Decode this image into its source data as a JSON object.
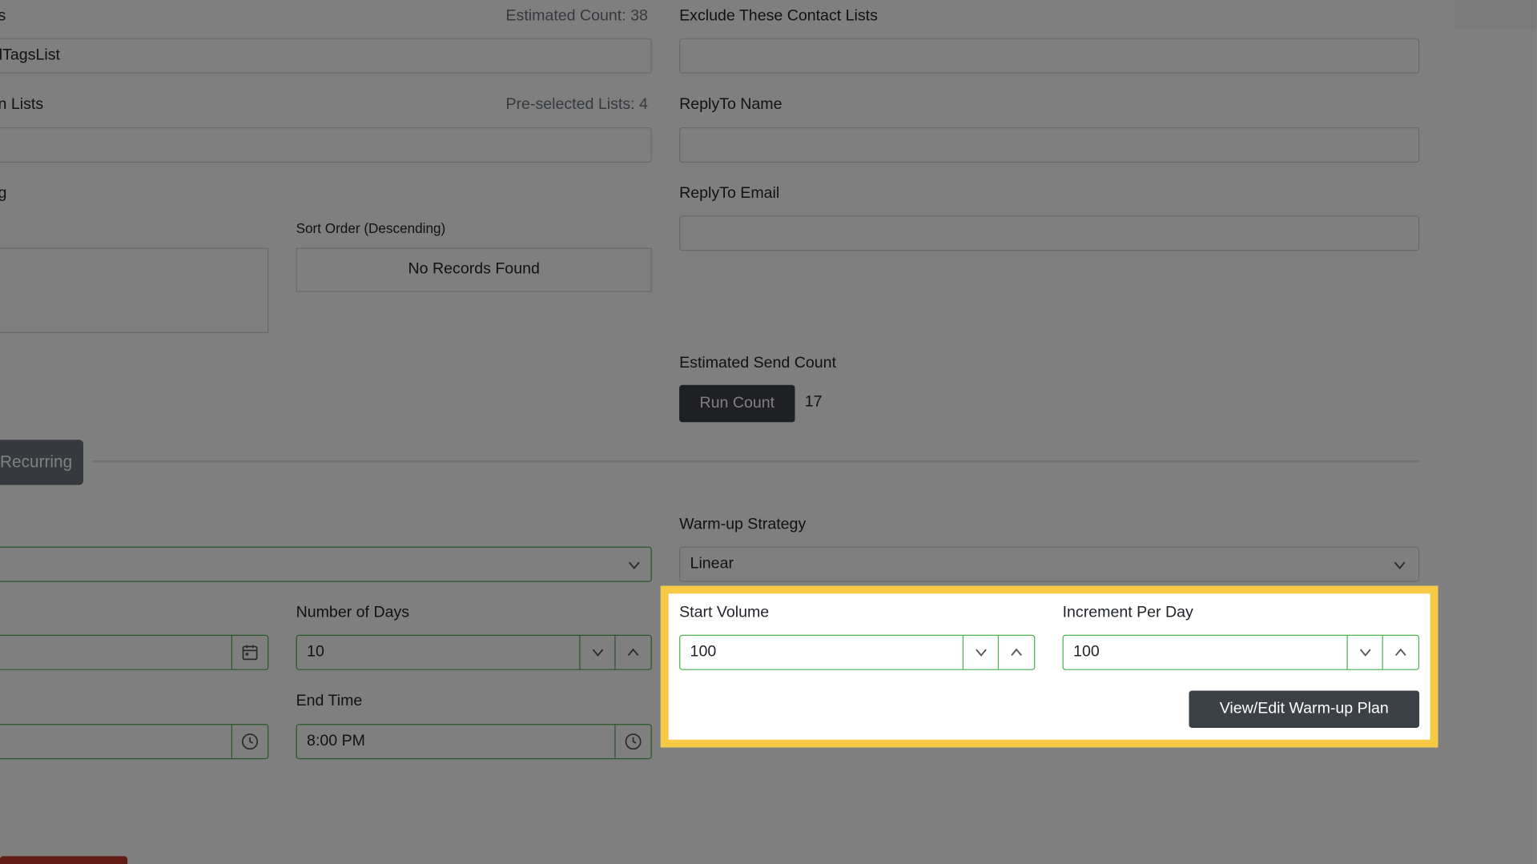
{
  "left_column": {
    "tags_label_partial": "s",
    "estimated_count": "Estimated Count: 38",
    "tags_input_value": "lTagsList",
    "lists_label_partial": "n Lists",
    "preselected_lists": "Pre-selected Lists: 4",
    "sorting_label_partial": "g",
    "sort_order_label": "Sort Order (Descending)",
    "no_records": "No Records Found",
    "recurring_tab": "Recurring",
    "number_of_days_label": "Number of Days",
    "number_of_days_value": "10",
    "end_time_label": "End Time",
    "end_time_value": "8:00 PM"
  },
  "right_column": {
    "exclude_lists_label": "Exclude These Contact Lists",
    "replyto_name_label": "ReplyTo Name",
    "replyto_email_label": "ReplyTo Email",
    "estimated_send_label": "Estimated Send Count",
    "run_count_button": "Run Count",
    "send_count_value": "17",
    "warmup_strategy_label": "Warm-up Strategy",
    "warmup_strategy_value": "Linear",
    "start_volume_label": "Start Volume",
    "start_volume_value": "100",
    "increment_label": "Increment Per Day",
    "increment_value": "100",
    "view_edit_button": "View/Edit Warm-up Plan"
  },
  "icons": {
    "chevron": "chevron-down-icon",
    "up": "chevron-up-icon",
    "calendar": "calendar-icon",
    "clock": "clock-icon"
  },
  "colors": {
    "highlight": "#f7ca45",
    "dark_button": "#3c4147",
    "valid_border": "#4caf50",
    "overlay": "rgba(0,0,0,0.5)"
  }
}
